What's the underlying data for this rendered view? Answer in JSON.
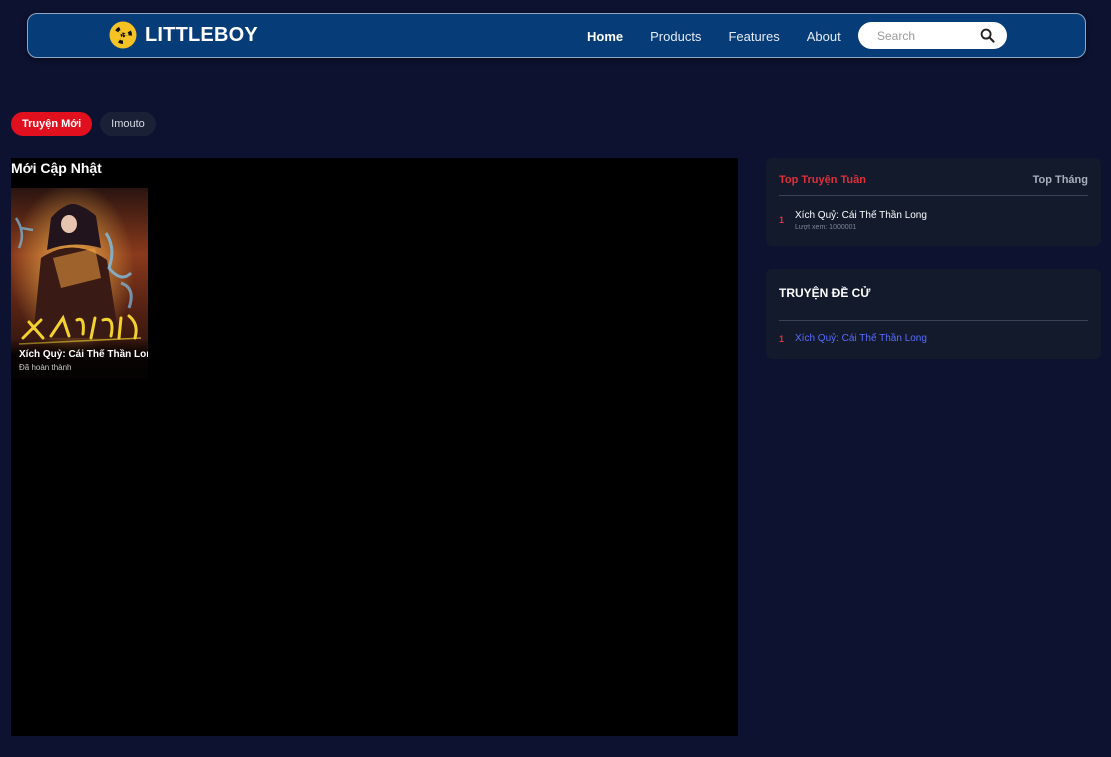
{
  "navbar": {
    "brand": "LITTLEBOY",
    "brand_icon": "radiation-icon",
    "links": [
      "Home",
      "Products",
      "Features",
      "About"
    ],
    "active_link": "Home",
    "search": {
      "placeholder": "Search",
      "value": "",
      "icon": "search-icon"
    }
  },
  "tabs": {
    "items": [
      "Truyện Mới",
      "Imouto"
    ],
    "active": "Truyện Mới"
  },
  "main": {
    "section_title": "Mới Cập Nhật",
    "comics": [
      {
        "name": "Xích Quỷ: Cái Thế Thần Long",
        "status": "Đã hoàn thành"
      }
    ]
  },
  "top": {
    "tab_week": "Top Truyện Tuần",
    "tab_month": "Top Tháng",
    "items": [
      {
        "rank": "1",
        "title": "Xích Quỷ: Cái Thế Thần Long",
        "views": "Lượt xem: 1000001"
      }
    ]
  },
  "recommended": {
    "title": "TRUYỆN ĐỀ CỬ",
    "items": [
      {
        "rank": "1",
        "title": "Xích Quỷ: Cái Thế Thần Long"
      }
    ]
  },
  "colors": {
    "page_bg": "#0c1230",
    "navbar_bg": "#063c77",
    "accent_red": "#e0101e",
    "link_blue": "#5b6cff"
  }
}
